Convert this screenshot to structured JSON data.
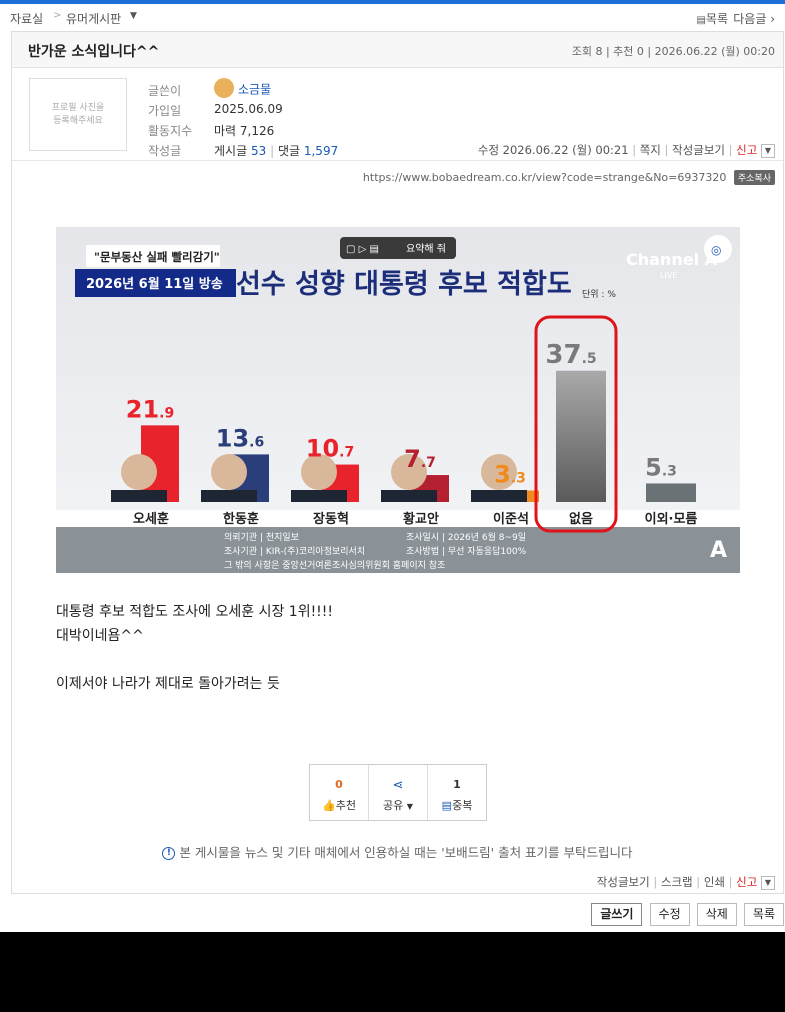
{
  "breadcrumb": {
    "root": "자료실",
    "board": "유머게시판",
    "list_label": "목록",
    "next_label": "다음글"
  },
  "post": {
    "title": "반가운 소식입니다^^",
    "meta": "조회 8 | 추천 0 | 2026.06.22 (월) 00:20"
  },
  "author": {
    "photo_placeholder": "프로필 사진을 등록해주세요",
    "labels": {
      "writer": "글쓴이",
      "joined": "가입일",
      "activity": "활동지수",
      "posts": "작성글"
    },
    "nickname": "소금물",
    "joined": "2025.06.09",
    "activity": "마력 7,126",
    "posts_label": "게시글",
    "posts_count": "53",
    "comments_label": "댓글",
    "comments_count": "1,597"
  },
  "post_actions": {
    "edit_time": "수정 2026.06.22 (월) 00:21",
    "note": "쪽지",
    "view_posts": "작성글보기",
    "report": "신고"
  },
  "url": {
    "text": "https://www.bobaedream.co.kr/view?code=strange&No=6937320",
    "copy_label": "주소복사"
  },
  "broadcast": {
    "tag_quote": "\"문부동산 실패 빨리감기\"",
    "date_banner": "2026년 6월 11일 방송",
    "headline": "선수 성향 대통령 후보 적합도",
    "unit": "단위 : %",
    "channel": "Channel A",
    "channel_sub": "LIVE",
    "summary_btn": "요약해 줘",
    "source_lines": [
      "의뢰기관 | 천지일보",
      "조사기관 | KIR-(주)코리아정보리서치",
      "조사일시 | 2026년 6월 8~9일",
      "조사방법 | 무선 자동응답100%",
      "그 밖의 사항은 중앙선거여론조사심의위원회 홈페이지 참조"
    ]
  },
  "chart_data": {
    "type": "bar",
    "title": "선수 성향 대통령 후보 적합도",
    "ylabel": "단위 : %",
    "categories": [
      "오세훈",
      "한동훈",
      "장동혁",
      "황교안",
      "이준석",
      "없음",
      "이외·모름"
    ],
    "values": [
      21.9,
      13.6,
      10.7,
      7.7,
      3.3,
      37.5,
      5.3
    ],
    "labels": [
      {
        "int": "21",
        "dec": ".9"
      },
      {
        "int": "13",
        "dec": ".6"
      },
      {
        "int": "10",
        "dec": ".7"
      },
      {
        "int": "7",
        "dec": ".7"
      },
      {
        "int": "3",
        "dec": ".3"
      },
      {
        "int": "37",
        "dec": ".5"
      },
      {
        "int": "5",
        "dec": ".3"
      }
    ],
    "colors": [
      "#e8232c",
      "#2a3e7a",
      "#e8232c",
      "#b42030",
      "#f08a1e",
      "#888888",
      "#6a7275"
    ],
    "ylim": [
      0,
      40
    ],
    "highlight": "없음"
  },
  "body": {
    "lines": [
      "대통령 후보 적합도 조사에 오세훈 시장 1위!!!!",
      "대박이네욤^^",
      "",
      "이제서야 나라가 제대로 돌아가려는 듯"
    ]
  },
  "reactions": {
    "like_count": "0",
    "like_label": "추천",
    "share_label": "공유",
    "dup_count": "1",
    "dup_label": "중복"
  },
  "notice": "본 게시물을 뉴스 및 기타 매체에서 인용하실 때는 '보배드림' 출처 표기를 부탁드립니다",
  "footer_actions": {
    "view_posts": "작성글보기",
    "scrap": "스크랩",
    "print": "인쇄",
    "report": "신고"
  },
  "buttons": {
    "write": "글쓰기",
    "edit": "수정",
    "delete": "삭제",
    "list": "목록"
  }
}
